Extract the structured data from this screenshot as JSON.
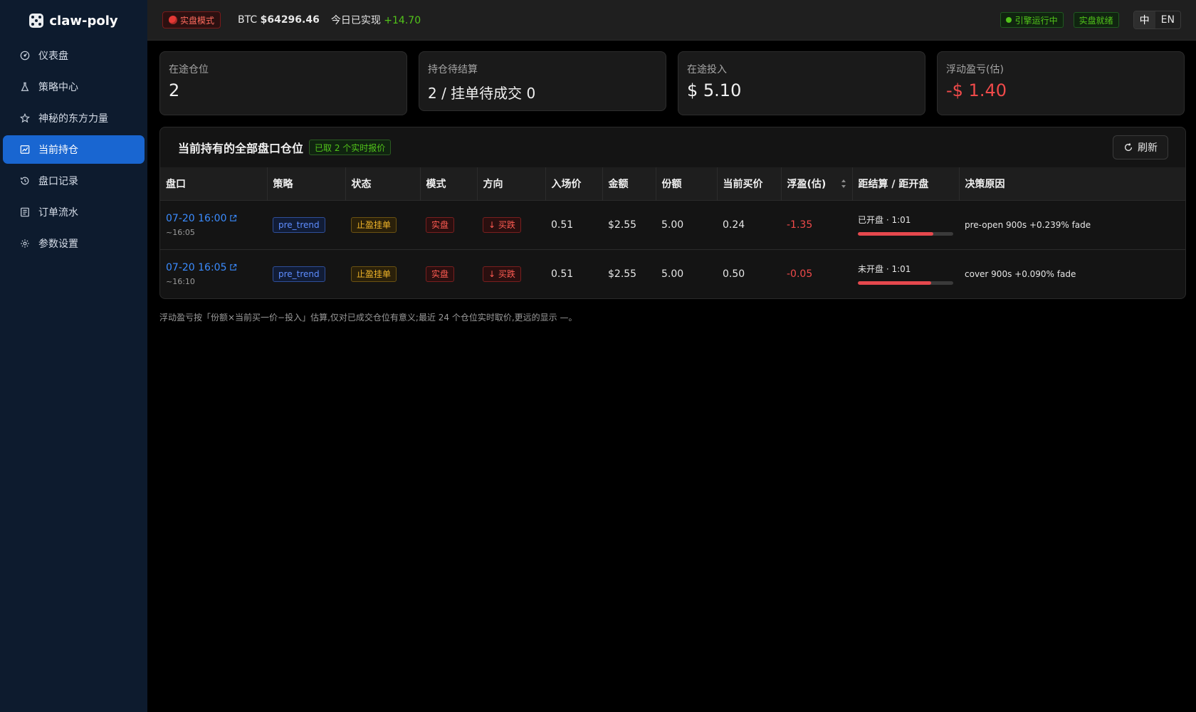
{
  "brand": {
    "name": "claw-poly"
  },
  "sidebar": {
    "items": [
      {
        "label": "仪表盘",
        "icon": "dashboard-icon"
      },
      {
        "label": "策略中心",
        "icon": "flask-icon"
      },
      {
        "label": "神秘的东方力量",
        "icon": "star-icon"
      },
      {
        "label": "当前持仓",
        "icon": "chart-icon",
        "active": true
      },
      {
        "label": "盘口记录",
        "icon": "history-icon"
      },
      {
        "label": "订单流水",
        "icon": "list-icon"
      },
      {
        "label": "参数设置",
        "icon": "gear-icon"
      }
    ]
  },
  "topbar": {
    "mode_label": "实盘模式",
    "btc_prefix": "BTC",
    "btc_price": "$64296.46",
    "realized_label": "今日已实现",
    "realized_value": "+14.70",
    "engine_status": "引擎运行中",
    "live_ready": "实盘就绪",
    "lang_zh": "中",
    "lang_en": "EN"
  },
  "cards": [
    {
      "label": "在途仓位",
      "value": "2"
    },
    {
      "label": "持仓待结算",
      "value": "2 / 挂单待成交 0"
    },
    {
      "label": "在途投入",
      "value": "$ 5.10"
    },
    {
      "label": "浮动盈亏(估)",
      "value": "-$ 1.40"
    }
  ],
  "panel": {
    "title": "当前持有的全部盘口仓位",
    "quote_tag": "已取 2 个实时报价",
    "refresh_label": "刷新"
  },
  "table": {
    "headers": [
      "盘口",
      "策略",
      "状态",
      "模式",
      "方向",
      "入场价",
      "金额",
      "份额",
      "当前买价",
      "浮盈(估)",
      "距结算 / 距开盘",
      "决策原因"
    ],
    "rows": [
      {
        "market": "07-20 16:00",
        "market_sub": "~16:05",
        "strategy": "pre_trend",
        "status": "止盈挂单",
        "mode": "实盘",
        "direction": "↓ 买跌",
        "entry": "0.51",
        "amount": "$2.55",
        "shares": "5.00",
        "bid": "0.24",
        "pnl": "-1.35",
        "timer": "已开盘 · 1:01",
        "progress": 0.79,
        "reason": "pre-open 900s +0.239% fade"
      },
      {
        "market": "07-20 16:05",
        "market_sub": "~16:10",
        "strategy": "pre_trend",
        "status": "止盈挂单",
        "mode": "实盘",
        "direction": "↓ 买跌",
        "entry": "0.51",
        "amount": "$2.55",
        "shares": "5.00",
        "bid": "0.50",
        "pnl": "-0.05",
        "timer": "未开盘 · 1:01",
        "progress": 0.77,
        "reason": "cover 900s +0.090% fade"
      }
    ]
  },
  "footnote": "浮动盈亏按「份额×当前买一价−投入」估算,仅对已成交仓位有意义;最近 24 个仓位实时取价,更远的显示 —。"
}
